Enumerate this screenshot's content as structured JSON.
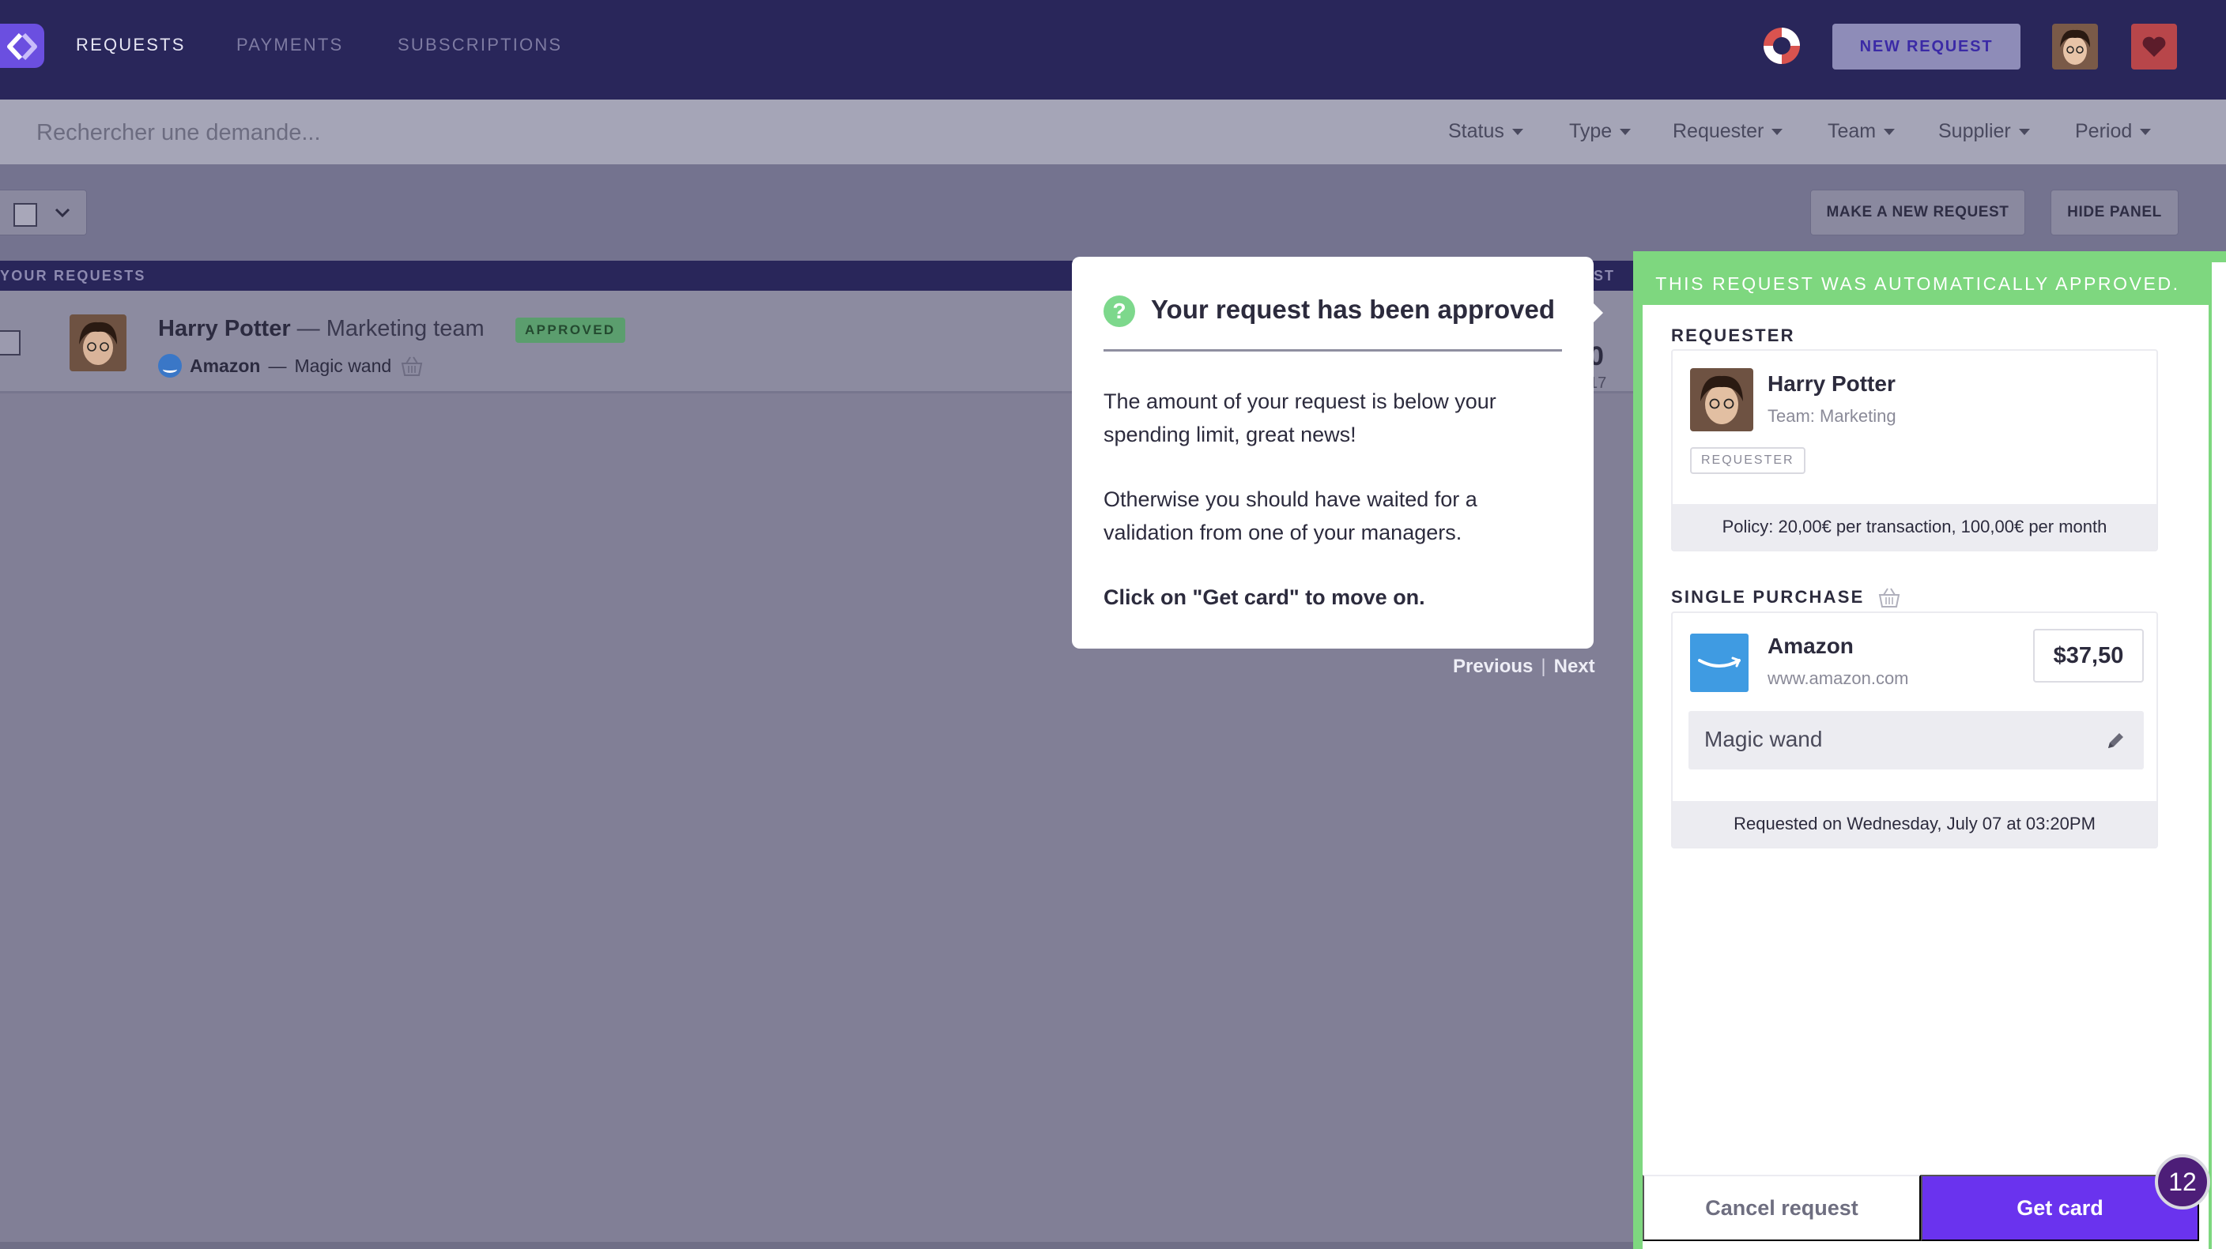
{
  "nav": {
    "items": [
      {
        "label": "REQUESTS",
        "active": true
      },
      {
        "label": "PAYMENTS",
        "active": false
      },
      {
        "label": "SUBSCRIPTIONS",
        "active": false
      }
    ],
    "new_request_label": "NEW REQUEST",
    "icons": {
      "logo": "app-logo-icon",
      "help": "lifebuoy-icon",
      "heart": "heart-icon"
    }
  },
  "search": {
    "placeholder": "Rechercher une demande..."
  },
  "filters": [
    "Status",
    "Type",
    "Requester",
    "Team",
    "Supplier",
    "Period"
  ],
  "toolbar": {
    "make_request_label": "MAKE A NEW REQUEST",
    "hide_panel_label": "HIDE PANEL"
  },
  "list": {
    "header_label": "YOUR REQUESTS",
    "header_right_fragment": "ST",
    "rows": [
      {
        "requester": "Harry Potter",
        "separator": " — ",
        "team": "Marketing team",
        "status": "APPROVED",
        "supplier": "Amazon",
        "description": "Magic wand",
        "amount_fragment": "0",
        "date_fragment": "17"
      }
    ]
  },
  "tour": {
    "title": "Your request has been approved",
    "paragraph1": "The amount of your request is below your spending limit, great news!",
    "paragraph2": "Otherwise you should have waited for a validation from one of your managers.",
    "cta": "Click on \"Get card\" to move on.",
    "previous_label": "Previous",
    "separator": "|",
    "next_label": "Next"
  },
  "panel": {
    "banner": "THIS REQUEST WAS AUTOMATICALLY APPROVED.",
    "requester_section": "REQUESTER",
    "requester_name": "Harry Potter",
    "requester_team": "Team: Marketing",
    "role_tag": "REQUESTER",
    "policy": "Policy: 20,00€ per transaction, 100,00€ per month",
    "purchase_section": "SINGLE PURCHASE",
    "supplier_name": "Amazon",
    "supplier_url": "www.amazon.com",
    "amount": "$37,50",
    "description": "Magic wand",
    "requested_on": "Requested on Wednesday, July 07 at 03:20PM",
    "cancel_label": "Cancel request",
    "get_card_label": "Get card"
  },
  "notification_count": "12",
  "colors": {
    "nav_bg": "#29265a",
    "accent_purple": "#6a33ee",
    "approved_green": "#7ed77f",
    "amazon_blue": "#3f9be2"
  }
}
